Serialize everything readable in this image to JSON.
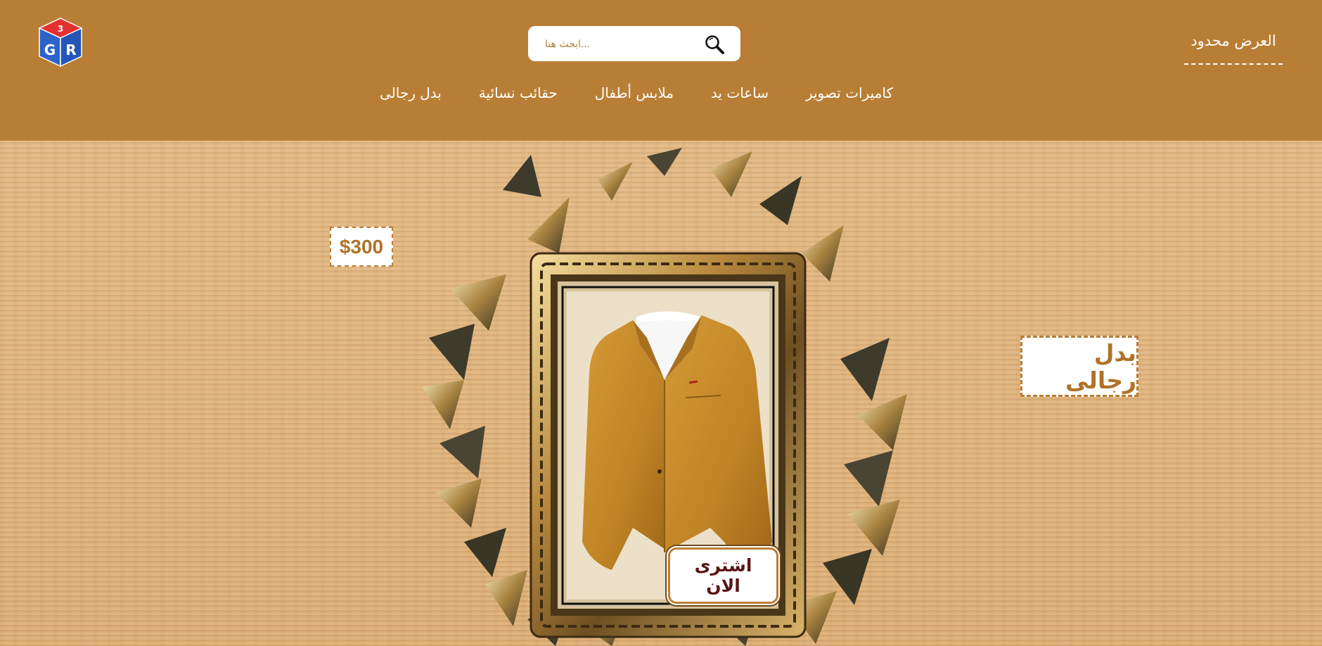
{
  "header": {
    "logo_letters": "GR",
    "offer_link": "العرض محدود",
    "search": {
      "placeholder": "...ابحث هنا",
      "value": ""
    },
    "nav": [
      {
        "label": "كاميرات تصوير"
      },
      {
        "label": "ساعات يد"
      },
      {
        "label": "ملابس أطفال"
      },
      {
        "label": "حقائب نسائية"
      },
      {
        "label": "بدل رجالى"
      }
    ]
  },
  "hero": {
    "price": "$300",
    "category": "بدل رجالى",
    "buy_button": "اشترى الان"
  },
  "colors": {
    "header_bg": "#b97e35",
    "accent": "#b07228",
    "button_text": "#5a1414"
  },
  "icons": {
    "logo": "cube-logo-icon",
    "search": "magnifier-icon"
  }
}
